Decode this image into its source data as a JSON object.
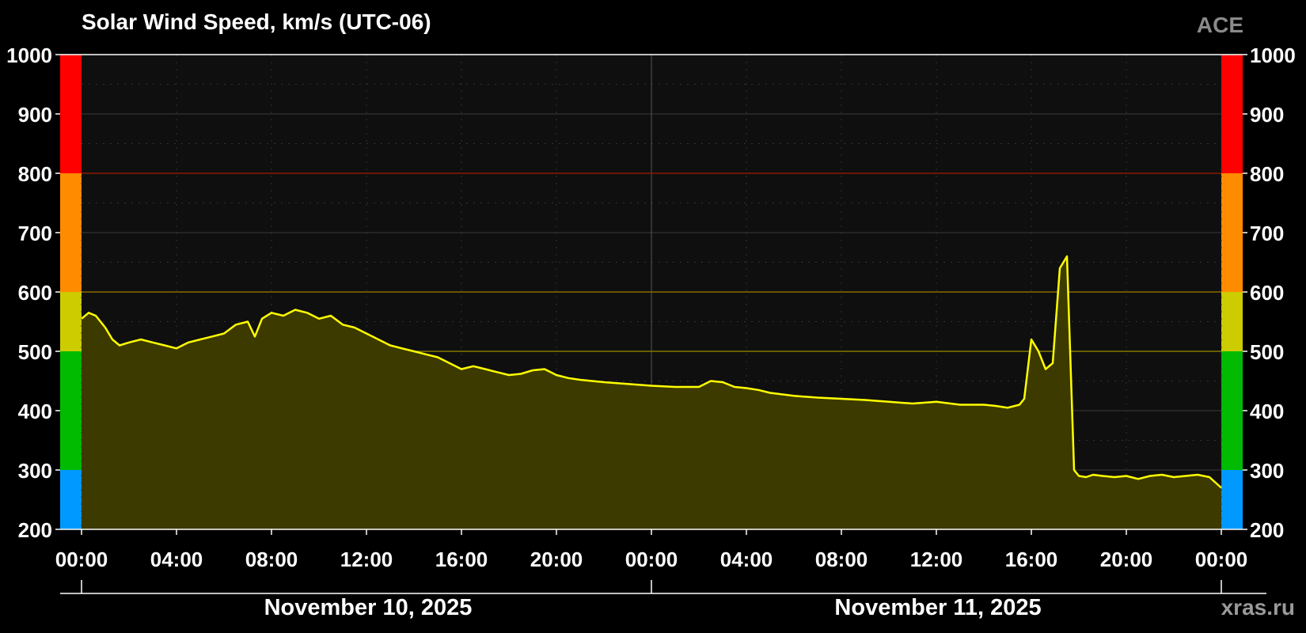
{
  "header": {
    "title": "Solar Wind Speed, km/s (UTC-06)",
    "source": "ACE",
    "watermark": "xras.ru"
  },
  "colors": {
    "background": "#000000",
    "plot_background": "#0f0f0f",
    "line": "#ffff00",
    "fill": "#3d3a00",
    "level_blue": "#0099ff",
    "level_green": "#00bb00",
    "level_yellow": "#cccc00",
    "level_orange": "#ff8c00",
    "level_red": "#ff0000"
  },
  "chart_data": {
    "type": "area",
    "title": "Solar Wind Speed, km/s (UTC-06)",
    "xlabel": "",
    "ylabel": "",
    "ylim": [
      200,
      1000
    ],
    "yticks": [
      200,
      300,
      400,
      500,
      600,
      700,
      800,
      900,
      1000
    ],
    "x_tick_labels": [
      "00:00",
      "04:00",
      "08:00",
      "12:00",
      "16:00",
      "20:00",
      "00:00",
      "04:00",
      "08:00",
      "12:00",
      "16:00",
      "20:00",
      "00:00"
    ],
    "x_range_hours": [
      0,
      48
    ],
    "dates": [
      {
        "label": "November 10, 2025",
        "start_hour": 0,
        "end_hour": 24
      },
      {
        "label": "November 11, 2025",
        "start_hour": 24,
        "end_hour": 48
      }
    ],
    "threshold_lines": [
      500,
      600,
      800
    ],
    "level_bands": [
      {
        "from": 200,
        "to": 300,
        "color": "#0099ff"
      },
      {
        "from": 300,
        "to": 500,
        "color": "#00bb00"
      },
      {
        "from": 500,
        "to": 600,
        "color": "#cccc00"
      },
      {
        "from": 600,
        "to": 800,
        "color": "#ff8c00"
      },
      {
        "from": 800,
        "to": 1000,
        "color": "#ff0000"
      }
    ],
    "grid": true,
    "series": [
      {
        "x_hours": [
          0,
          0.3,
          0.6,
          1.0,
          1.3,
          1.6,
          2.0,
          2.5,
          3.0,
          3.5,
          4.0,
          4.5,
          5.0,
          5.5,
          6.0,
          6.5,
          7.0,
          7.3,
          7.6,
          8.0,
          8.5,
          9.0,
          9.5,
          10.0,
          10.5,
          11.0,
          11.5,
          12.0,
          12.5,
          13.0,
          13.5,
          14.0,
          14.5,
          15.0,
          15.5,
          16.0,
          16.5,
          17.0,
          17.5,
          18.0,
          18.5,
          19.0,
          19.5,
          20.0,
          20.5,
          21.0,
          22.0,
          23.0,
          24.0,
          25.0,
          26.0,
          26.5,
          27.0,
          27.5,
          28.0,
          28.5,
          29.0,
          30.0,
          31.0,
          32.0,
          33.0,
          34.0,
          35.0,
          36.0,
          37.0,
          38.0,
          38.5,
          39.0,
          39.5,
          39.7,
          40.0,
          40.3,
          40.6,
          40.9,
          41.2,
          41.5,
          41.8,
          42.0,
          42.3,
          42.6,
          43.0,
          43.5,
          44.0,
          44.5,
          45.0,
          45.5,
          46.0,
          46.5,
          47.0,
          47.5,
          48.0
        ],
        "values": [
          555,
          565,
          560,
          540,
          520,
          510,
          515,
          520,
          515,
          510,
          505,
          515,
          520,
          525,
          530,
          545,
          550,
          525,
          555,
          565,
          560,
          570,
          565,
          555,
          560,
          545,
          540,
          530,
          520,
          510,
          505,
          500,
          495,
          490,
          480,
          470,
          475,
          470,
          465,
          460,
          462,
          468,
          470,
          460,
          455,
          452,
          448,
          445,
          442,
          440,
          440,
          450,
          448,
          440,
          438,
          435,
          430,
          425,
          422,
          420,
          418,
          415,
          412,
          415,
          410,
          410,
          408,
          405,
          410,
          420,
          520,
          500,
          470,
          480,
          640,
          660,
          300,
          290,
          288,
          292,
          290,
          288,
          290,
          285,
          290,
          292,
          288,
          290,
          292,
          288,
          270
        ]
      }
    ]
  }
}
